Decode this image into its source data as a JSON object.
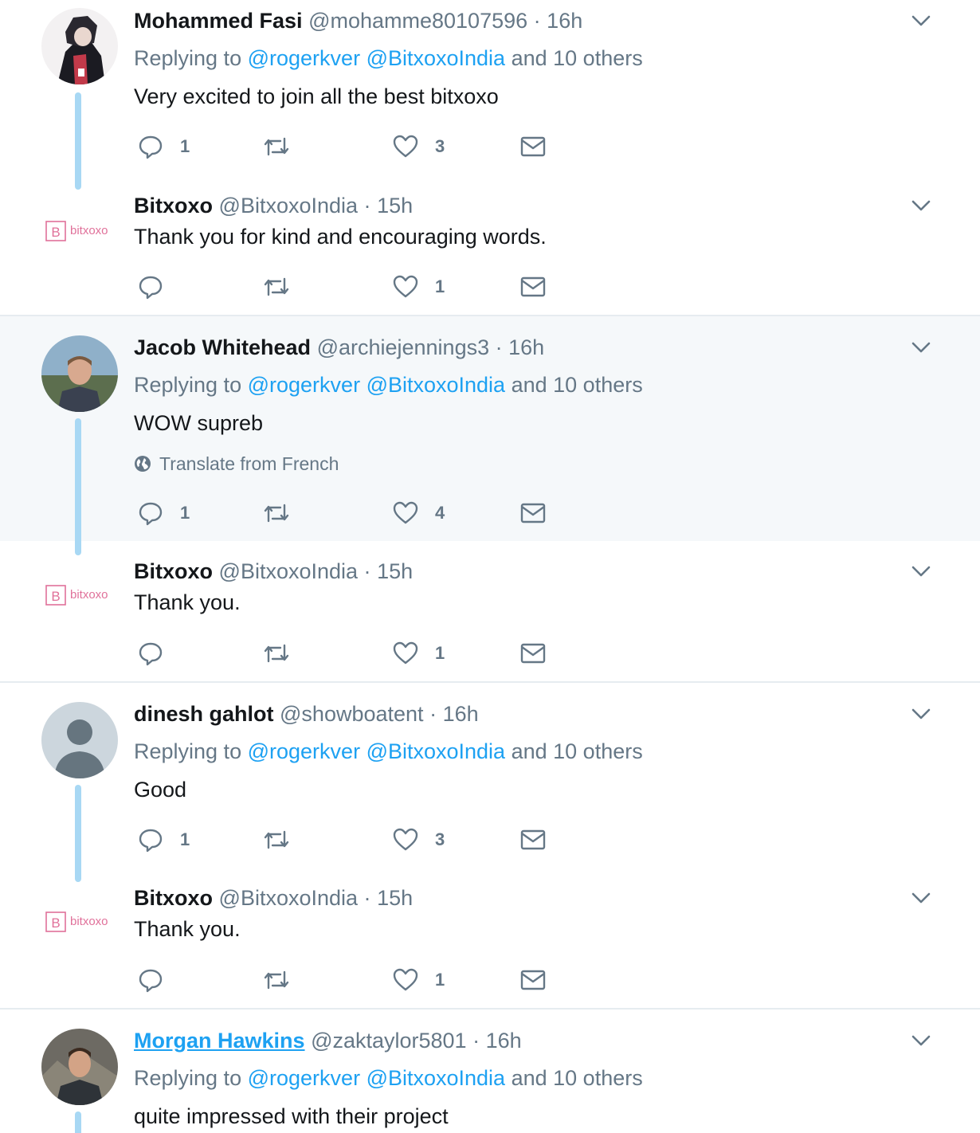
{
  "colors": {
    "link": "#1da1f2",
    "muted": "#657786",
    "thread_line": "#a8d8f4",
    "highlight_bg": "#f5f8fa",
    "logo_pink": "#e0719a"
  },
  "threads": [
    {
      "tweets": [
        {
          "name": "Mohammed Fasi",
          "handle": "@mohamme80107596",
          "sep": "·",
          "time": "16h",
          "replying_prefix": "Replying to",
          "mention1": "@rogerkver",
          "mention2": "@BitxoxoIndia",
          "replying_suffix": "and 10 others",
          "text": "Very excited to join all the best bitxoxo",
          "reply_count": "1",
          "like_count": "3"
        },
        {
          "name": "Bitxoxo",
          "handle": "@BitxoxoIndia",
          "sep": "·",
          "time": "15h",
          "text": "Thank you for kind and encouraging words.",
          "like_count": "1",
          "logo_text": "bitxoxo"
        }
      ]
    },
    {
      "tweets": [
        {
          "name": "Jacob Whitehead",
          "handle": "@archiejennings3",
          "sep": "·",
          "time": "16h",
          "replying_prefix": "Replying to",
          "mention1": "@rogerkver",
          "mention2": "@BitxoxoIndia",
          "replying_suffix": "and 10 others",
          "text": "WOW supreb",
          "translate": "Translate from French",
          "reply_count": "1",
          "like_count": "4"
        },
        {
          "name": "Bitxoxo",
          "handle": "@BitxoxoIndia",
          "sep": "·",
          "time": "15h",
          "text": "Thank you.",
          "like_count": "1",
          "logo_text": "bitxoxo"
        }
      ]
    },
    {
      "tweets": [
        {
          "name": "dinesh gahlot",
          "handle": "@showboatent",
          "sep": "·",
          "time": "16h",
          "replying_prefix": "Replying to",
          "mention1": "@rogerkver",
          "mention2": "@BitxoxoIndia",
          "replying_suffix": "and 10 others",
          "text": "Good",
          "reply_count": "1",
          "like_count": "3"
        },
        {
          "name": "Bitxoxo",
          "handle": "@BitxoxoIndia",
          "sep": "·",
          "time": "15h",
          "text": "Thank you.",
          "like_count": "1",
          "logo_text": "bitxoxo"
        }
      ]
    },
    {
      "tweets": [
        {
          "name": "Morgan Hawkins",
          "handle": "@zaktaylor5801",
          "sep": "·",
          "time": "16h",
          "replying_prefix": "Replying to",
          "mention1": "@rogerkver",
          "mention2": "@BitxoxoIndia",
          "replying_suffix": "and 10 others",
          "text": "quite impressed with their project"
        }
      ]
    }
  ]
}
